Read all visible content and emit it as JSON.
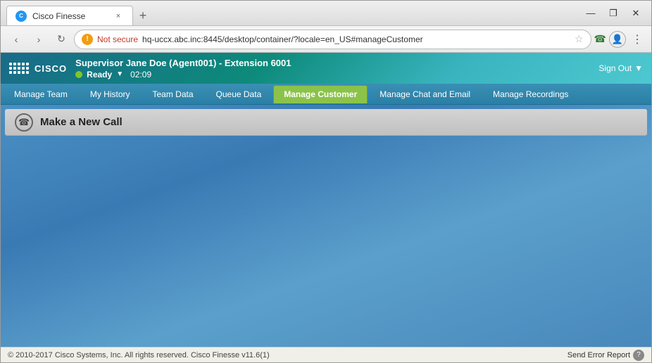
{
  "browser": {
    "tab_title": "Cisco Finesse",
    "new_tab_label": "+",
    "close_tab_label": "×",
    "minimize_label": "—",
    "restore_label": "❐",
    "close_window_label": "✕",
    "back_btn": "‹",
    "forward_btn": "›",
    "refresh_btn": "↻",
    "not_secure_label": "Not secure",
    "url": "hq-uccx.abc.inc:8445/desktop/container/?locale=en_US#manageCustomer",
    "star_icon": "☆",
    "phone_icon": "☎",
    "menu_icon": "⋮"
  },
  "finesse": {
    "cisco_text": "CISCO",
    "agent_name": "Supervisor Jane Doe (Agent001) - Extension 6001",
    "status": "Ready",
    "status_time": "02:09",
    "sign_out": "Sign Out",
    "tabs": [
      {
        "id": "manage-team",
        "label": "Manage Team",
        "active": false
      },
      {
        "id": "my-history",
        "label": "My History",
        "active": false
      },
      {
        "id": "team-data",
        "label": "Team Data",
        "active": false
      },
      {
        "id": "queue-data",
        "label": "Queue Data",
        "active": false
      },
      {
        "id": "manage-customer",
        "label": "Manage Customer",
        "active": true
      },
      {
        "id": "manage-chat-email",
        "label": "Manage Chat and Email",
        "active": false
      },
      {
        "id": "manage-recordings",
        "label": "Manage Recordings",
        "active": false
      }
    ],
    "call_label": "Make a New Call",
    "footer_copyright": "© 2010-2017 Cisco Systems, Inc. All rights reserved. Cisco Finesse v11.6(1)",
    "send_error": "Send Error Report",
    "help": "?"
  }
}
